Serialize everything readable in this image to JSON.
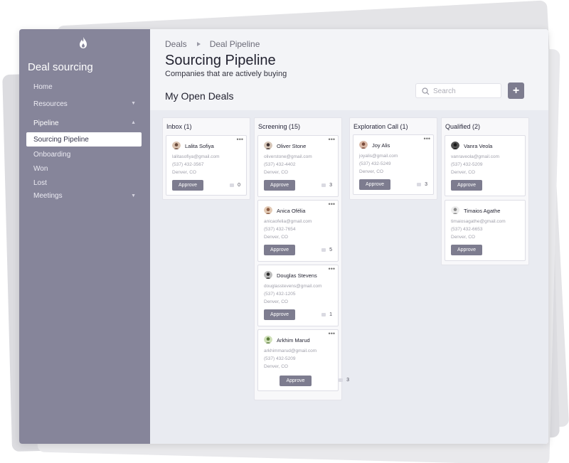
{
  "app": {
    "title": "Deal sourcing"
  },
  "sidebar": {
    "items": [
      {
        "label": "Home"
      },
      {
        "label": "Resources"
      },
      {
        "label": "Pipeline"
      },
      {
        "label": "Sourcing Pipeline"
      },
      {
        "label": "Onboarding"
      },
      {
        "label": "Won"
      },
      {
        "label": "Lost"
      },
      {
        "label": "Meetings"
      }
    ]
  },
  "breadcrumb": {
    "root": "Deals",
    "current": "Deal Pipeline"
  },
  "page": {
    "title": "Sourcing Pipeline",
    "subtitle": "Companies that are actively buying",
    "section": "My Open Deals"
  },
  "search": {
    "placeholder": "Search"
  },
  "add_button": {
    "label": "+"
  },
  "columns": [
    {
      "title": "Inbox (1)",
      "cards": [
        {
          "name": "Lalita Sofiya",
          "email": "lalitasofiya@gmail.com",
          "phone": "(537) 432-3567",
          "location": "Denver, CO",
          "action": "Approve",
          "comments": "0",
          "avatar_color": "#6a4a3a"
        }
      ]
    },
    {
      "title": "Screening (15)",
      "cards": [
        {
          "name": "Oliver Stone",
          "email": "oliverstone@gmail.com",
          "phone": "(537) 432-4402",
          "location": "Denver, CO",
          "action": "Approve",
          "comments": "3",
          "avatar_color": "#3d3030"
        },
        {
          "name": "Anica Ofélia",
          "email": "anicaofelia@gmail.com",
          "phone": "(537) 432-7654",
          "location": "Denver, CO",
          "action": "Approve",
          "comments": "5",
          "avatar_color": "#8a5a40"
        },
        {
          "name": "Douglas Stevens",
          "email": "douglasstevens@gmail.com",
          "phone": "(537) 432-1205",
          "location": "Denver, CO",
          "action": "Approve",
          "comments": "1",
          "avatar_color": "#2b2b2b"
        },
        {
          "name": "Arkhim Marud",
          "email": "arkhimmarud@gmail.com",
          "phone": "(537) 432-5209",
          "location": "Denver, CO",
          "action": "Approve",
          "comments": "3",
          "avatar_color": "#5a7a3a"
        }
      ]
    },
    {
      "title": "Exploration Call (1)",
      "cards": [
        {
          "name": "Joy Alis",
          "email": "joyalis@gmail.com",
          "phone": "(537) 432-5249",
          "location": "Denver, CO",
          "action": "Approve",
          "comments": "3",
          "avatar_color": "#7a4a3a"
        }
      ]
    },
    {
      "title": "Qualified (2)",
      "cards": [
        {
          "name": "Vanra Veola",
          "email": "vanraveola@gmail.com",
          "phone": "(537) 432-5209",
          "location": "Denver, CO",
          "action": "Approve",
          "comments": "",
          "avatar_color": "#202020"
        },
        {
          "name": "Timaios Agathe",
          "email": "timaiosagathe@gmail.com",
          "phone": "(537) 432-6653",
          "location": "Denver, CO",
          "action": "Approve",
          "comments": "",
          "avatar_color": "#c8c8c8"
        }
      ]
    }
  ]
}
